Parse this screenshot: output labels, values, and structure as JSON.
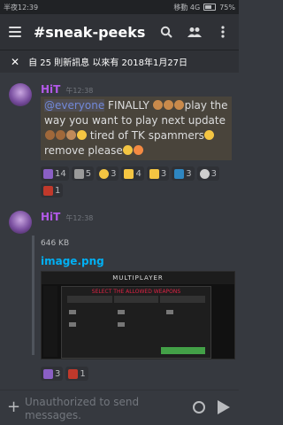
{
  "status_bar": {
    "left": "半夜12:39",
    "right": "移動 4G",
    "battery": "75%"
  },
  "header": {
    "title": "#sneak-peeks"
  },
  "banner": {
    "text": "自 25 則新訊息 以來有 2018年1月27日"
  },
  "messages": [
    {
      "author": "HiT",
      "time": "午12:38",
      "mention": "@everyone",
      "text_1": " FINALLY ",
      "text_2": "play the way you want to play next update",
      "text_3": " tired of TK spammers",
      "text_4": " remove please",
      "reactions": [
        {
          "icon": "purple-emote",
          "count": "14"
        },
        {
          "icon": "alien-emote",
          "count": "5"
        },
        {
          "icon": "cool-emote",
          "count": "3"
        },
        {
          "icon": "fist-emote",
          "count": "4"
        },
        {
          "icon": "ok-hand-emote",
          "count": "3"
        },
        {
          "icon": "y-emote",
          "count": "3"
        },
        {
          "icon": "skull-emote",
          "count": "3"
        },
        {
          "icon": "red-emote",
          "count": "1"
        }
      ]
    },
    {
      "author": "HiT",
      "time": "午12:38",
      "file_size": "646 KB",
      "file_name": "image.png",
      "image_title": "MULTIPLAYER",
      "image_subtitle": "SELECT THE ALLOWED WEAPONS",
      "reactions": [
        {
          "icon": "purple-emote",
          "count": "3"
        },
        {
          "icon": "red-emote",
          "count": "1"
        }
      ]
    }
  ],
  "composer": {
    "placeholder": "Unauthorized to send messages."
  },
  "colors": {
    "accent": "#7289da",
    "author": "#b259e8",
    "link": "#00b0f4"
  }
}
